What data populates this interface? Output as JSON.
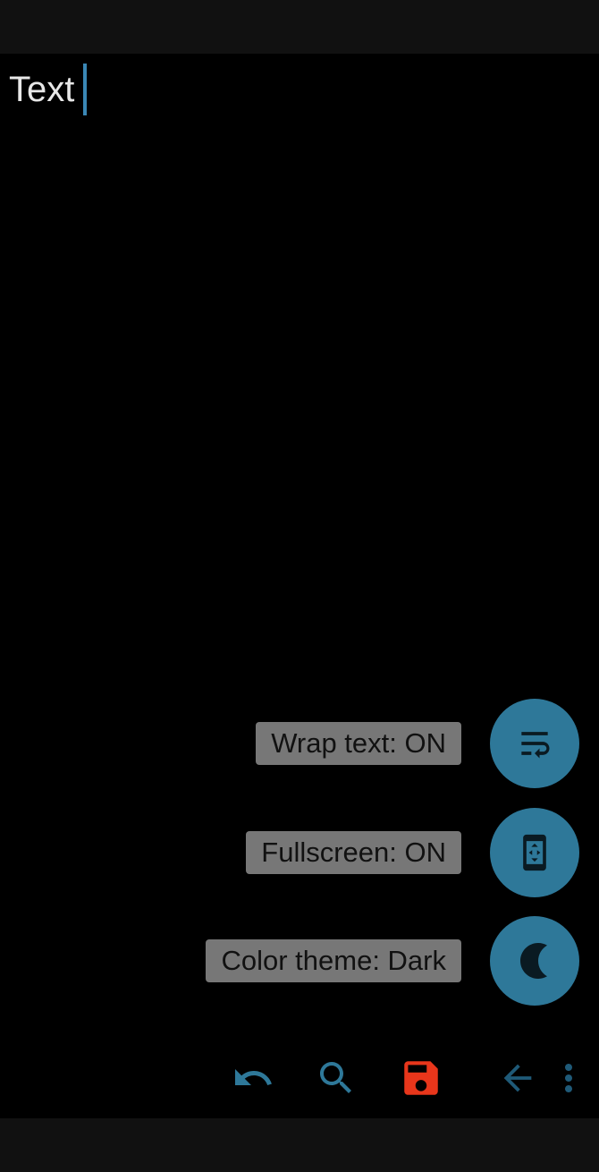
{
  "editor": {
    "content": "Text"
  },
  "fab_menu": {
    "items": [
      {
        "label": "Wrap text: ON",
        "icon": "wrap-text-icon"
      },
      {
        "label": "Fullscreen: ON",
        "icon": "fullscreen-icon"
      },
      {
        "label": "Color theme: Dark",
        "icon": "moon-icon"
      }
    ]
  },
  "toolbar": {
    "items": [
      {
        "icon": "undo-icon",
        "color": "#2e7899"
      },
      {
        "icon": "search-icon",
        "color": "#2e7899"
      },
      {
        "icon": "save-icon",
        "color": "#e8361b"
      },
      {
        "icon": "back-arrow-icon",
        "color": "#1f5a78"
      },
      {
        "icon": "more-vert-icon",
        "color": "#1f5a78"
      }
    ]
  },
  "colors": {
    "accent": "#2e7899",
    "save": "#e8361b",
    "caret": "#3a87b5",
    "label_bg": "#777777"
  }
}
